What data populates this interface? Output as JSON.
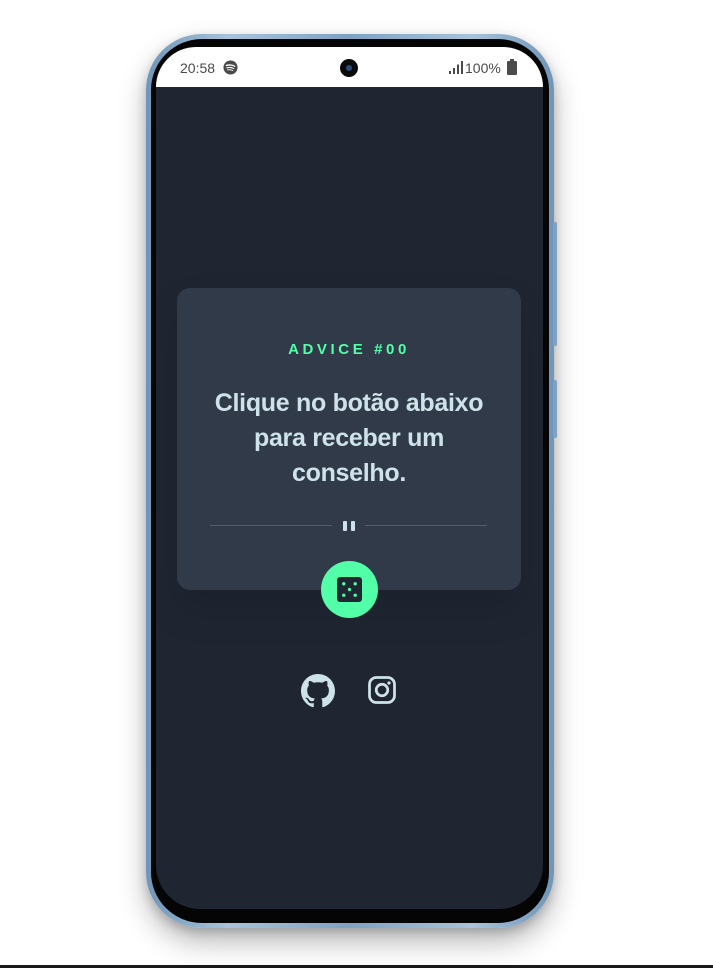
{
  "status_bar": {
    "time": "20:58",
    "battery": "100%",
    "icons": [
      "spotify-icon",
      "signal-icon",
      "battery-icon"
    ]
  },
  "advice": {
    "label": "ADVICE #00",
    "text": "Clique no botão abaixo para receber um conselho."
  },
  "divider": {
    "icon": "pause-icon"
  },
  "actions": {
    "dice_button_icon": "dice-icon"
  },
  "social": {
    "links": [
      "github-icon",
      "instagram-icon"
    ]
  },
  "colors": {
    "page_background": "#ffffff",
    "screen_background": "#1f2632",
    "card_background": "#313a49",
    "accent": "#52ffa8",
    "text": "#cee3e9",
    "divider": "#4f5d74",
    "phone_frame": "#7fa2c2"
  }
}
